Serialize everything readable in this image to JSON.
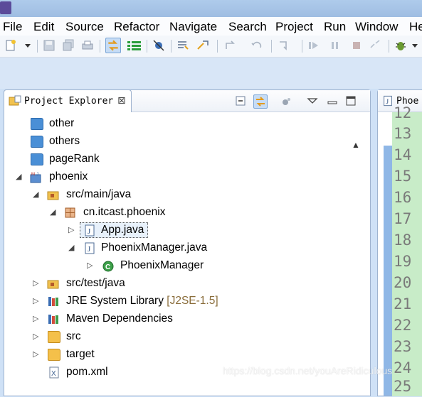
{
  "menubar": {
    "items": [
      "File",
      "Edit",
      "Source",
      "Refactor",
      "Navigate",
      "Search",
      "Project",
      "Run",
      "Window",
      "He"
    ]
  },
  "project_explorer": {
    "title": "Project Explorer",
    "close_glyph": "⊠",
    "tree": [
      {
        "label": "other",
        "icon": "folder-icon"
      },
      {
        "label": "others",
        "icon": "folder-icon"
      },
      {
        "label": "pageRank",
        "icon": "folder-icon"
      },
      {
        "label": "phoenix",
        "icon": "maven-project-icon",
        "expanded": true
      },
      {
        "label": "src/main/java",
        "icon": "source-folder-icon",
        "expanded": true
      },
      {
        "label": "cn.itcast.phoenix",
        "icon": "package-icon",
        "expanded": true
      },
      {
        "label": "App.java",
        "icon": "java-file-icon",
        "selected": true
      },
      {
        "label": "PhoenixManager.java",
        "icon": "java-file-icon",
        "expanded": true
      },
      {
        "label": "PhoenixManager",
        "icon": "class-icon"
      },
      {
        "label": "src/test/java",
        "icon": "source-folder-icon"
      },
      {
        "label": "JRE System Library",
        "decoration": "[J2SE-1.5]",
        "icon": "library-icon"
      },
      {
        "label": "Maven Dependencies",
        "icon": "library-icon"
      },
      {
        "label": "src",
        "icon": "folder-icon"
      },
      {
        "label": "target",
        "icon": "folder-icon"
      },
      {
        "label": "pom.xml",
        "icon": "xml-file-icon"
      }
    ]
  },
  "editor": {
    "tab_title": "Phoe",
    "line_numbers": [
      "12",
      "13",
      "14",
      "15",
      "16",
      "17",
      "18",
      "19",
      "20",
      "21",
      "22",
      "23",
      "24",
      "25"
    ]
  },
  "watermark": "https://blog.csdn.net/youAreRidiculous"
}
